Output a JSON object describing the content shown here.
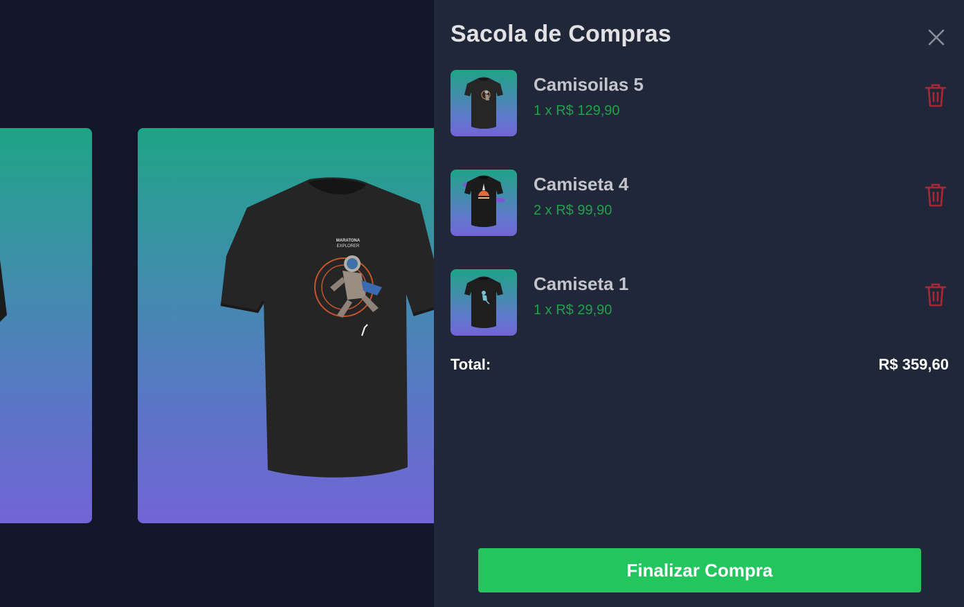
{
  "gallery": {
    "products": [
      {
        "id": "left-partial"
      },
      {
        "id": "main-shirt",
        "print_text": [
          "MARATONA",
          "EXPLORER"
        ]
      }
    ]
  },
  "cart": {
    "title": "Sacola de Compras",
    "close_icon": "close-icon",
    "items": [
      {
        "name": "Camisoilas 5",
        "price": "1 x R$ 129,90",
        "thumb_accent": "#d98a55"
      },
      {
        "name": "Camiseta 4",
        "price": "2 x R$ 99,90",
        "thumb_accent": "#e86a3a"
      },
      {
        "name": "Camiseta 1",
        "price": "1 x R$ 29,90",
        "thumb_accent": "#7cc0d8"
      }
    ],
    "total_label": "Total:",
    "total_value": "R$ 359,60",
    "checkout_label": "Finalizar Compra"
  },
  "colors": {
    "background": "#121829",
    "drawer": "#202738",
    "price_green": "#1fa34a",
    "checkout_green": "#22c55e",
    "trash_red": "#aa2834"
  }
}
